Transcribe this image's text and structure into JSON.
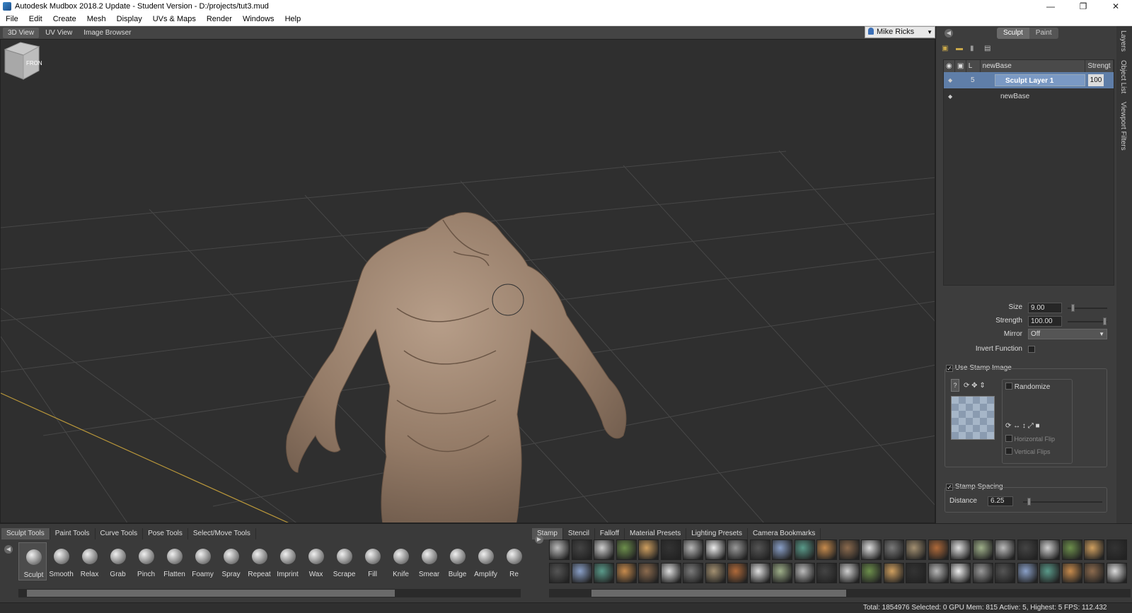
{
  "window": {
    "title": "Autodesk Mudbox 2018.2 Update - Student Version - D:/projects/tut3.mud",
    "minimize": "—",
    "maximize": "❐",
    "close": "✕"
  },
  "menu": [
    "File",
    "Edit",
    "Create",
    "Mesh",
    "Display",
    "UVs & Maps",
    "Render",
    "Windows",
    "Help"
  ],
  "view_tabs": [
    "3D View",
    "UV View",
    "Image Browser"
  ],
  "user": {
    "name": "Mike Ricks"
  },
  "viewcube": {
    "label": "FRONT"
  },
  "mode_toggle": {
    "sculpt": "Sculpt",
    "paint": "Paint"
  },
  "layers": {
    "headers": {
      "name": "newBase",
      "strength": "Strengt"
    },
    "rows": [
      {
        "level": "5",
        "name": "Sculpt Layer 1",
        "strength": "100",
        "selected": true
      },
      {
        "level": "",
        "name": "newBase",
        "strength": "",
        "selected": false
      }
    ]
  },
  "properties": {
    "size_label": "Size",
    "size_value": "9.00",
    "size_fraction": 0.09,
    "strength_label": "Strength",
    "strength_value": "100.00",
    "strength_fraction": 1.0,
    "mirror_label": "Mirror",
    "mirror_value": "Off",
    "invert_label": "Invert Function",
    "use_stamp_label": "Use Stamp Image",
    "randomize_label": "Randomize",
    "hflip_label": "Horizontal Flip",
    "vflip_label": "Vertical Flips",
    "stamp_spacing_label": "Stamp Spacing",
    "distance_label": "Distance",
    "distance_value": "6.25",
    "distance_fraction": 0.06
  },
  "side_tabs": [
    "Layers",
    "Object List",
    "Viewport Filters"
  ],
  "tool_tabs": [
    "Sculpt Tools",
    "Paint Tools",
    "Curve Tools",
    "Pose Tools",
    "Select/Move Tools"
  ],
  "tools": [
    "Sculpt",
    "Smooth",
    "Relax",
    "Grab",
    "Pinch",
    "Flatten",
    "Foamy",
    "Spray",
    "Repeat",
    "Imprint",
    "Wax",
    "Scrape",
    "Fill",
    "Knife",
    "Smear",
    "Bulge",
    "Amplify",
    "Re"
  ],
  "stamp_tabs": [
    "Stamp",
    "Stencil",
    "Falloff",
    "Material Presets",
    "Lighting Presets",
    "Camera Bookmarks"
  ],
  "status": "Total: 1854976  Selected: 0 GPU Mem: 815  Active: 5, Highest: 5  FPS: 112.432",
  "colors": {
    "accent_selected": "#5f7ea8",
    "clay": "#9c8370",
    "grid": "#4a4a4a",
    "axis": "#b8963a"
  },
  "icons": {
    "app": "mudbox-logo-icon",
    "user": "user-icon",
    "new_layer": "new-layer-icon",
    "folder": "folder-icon",
    "delete": "trash-icon",
    "merge": "merge-icon"
  }
}
